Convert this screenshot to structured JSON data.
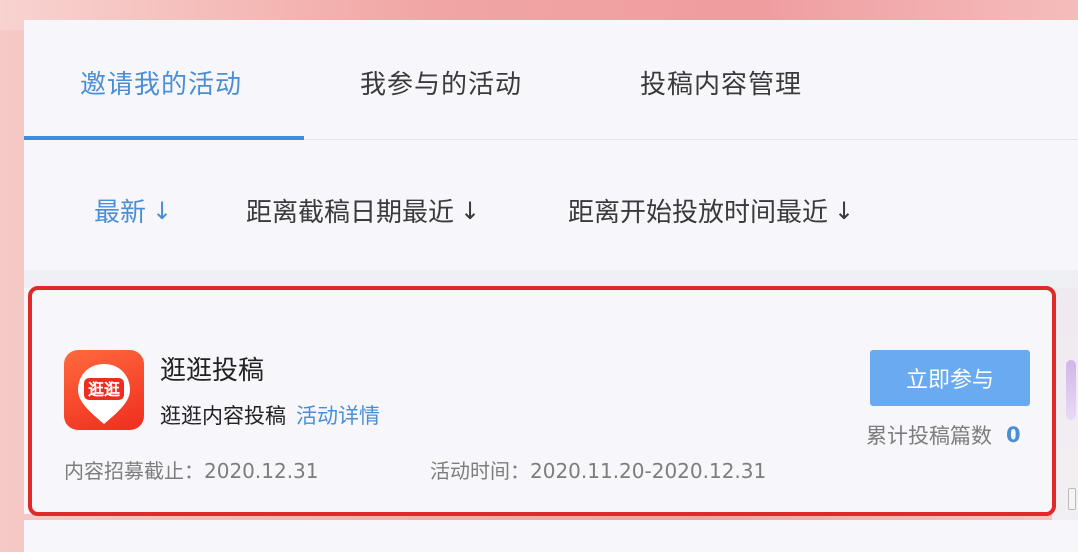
{
  "tabs": [
    {
      "label": "邀请我的活动",
      "active": true
    },
    {
      "label": "我参与的活动",
      "active": false
    },
    {
      "label": "投稿内容管理",
      "active": false
    }
  ],
  "filters": [
    {
      "label": "最新",
      "arrow": "↓",
      "active": true
    },
    {
      "label": "距离截稿日期最近",
      "arrow": "↓",
      "active": false
    },
    {
      "label": "距离开始投放时间最近",
      "arrow": "↓",
      "active": false
    }
  ],
  "card": {
    "icon_text": "逛逛",
    "title": "逛逛投稿",
    "subtitle": "逛逛内容投稿",
    "detail_link": "活动详情",
    "deadline_label": "内容招募截止：2020.12.31",
    "period_label": "活动时间：2020.11.20-2020.12.31",
    "join_button": "立即参与",
    "count_label": "累计投稿篇数",
    "count_value": "0"
  },
  "colors": {
    "accent": "#4a8fd6",
    "button": "#6aaaf0",
    "highlight": "#e02a2a",
    "icon": "#ef2d1f"
  }
}
